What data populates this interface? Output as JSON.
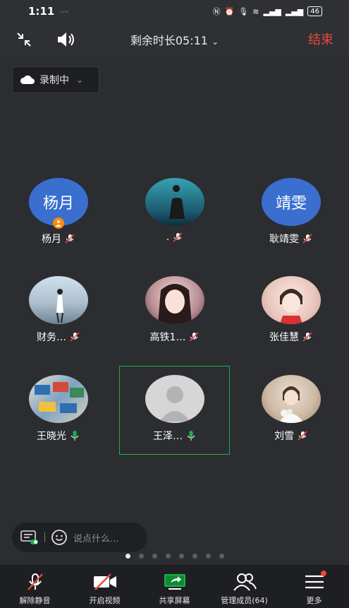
{
  "status_bar": {
    "time": "1:11",
    "battery": "46"
  },
  "top_bar": {
    "remaining": "剩余时长05:11",
    "end_label": "结束"
  },
  "record": {
    "label": "录制中"
  },
  "members": [
    {
      "name": "杨月",
      "avatar_text": "杨月",
      "host": true,
      "muted": true,
      "avatar_color": "#3a6fd0"
    },
    {
      "name": ".",
      "avatar_text": "",
      "host": false,
      "muted": true,
      "avatar_color": "#4aa3b8"
    },
    {
      "name": "耿靖雯",
      "avatar_text": "靖雯",
      "host": false,
      "muted": true,
      "avatar_color": "#3a6fd0"
    },
    {
      "name": "财务…",
      "avatar_text": "",
      "host": false,
      "muted": true,
      "avatar_color": "#9fb0c0"
    },
    {
      "name": "高铁1…",
      "avatar_text": "",
      "host": false,
      "muted": true,
      "avatar_color": "#d9b0b5"
    },
    {
      "name": "张佳慧",
      "avatar_text": "",
      "host": false,
      "muted": true,
      "avatar_color": "#e6c8c0"
    },
    {
      "name": "王晓光",
      "avatar_text": "",
      "host": false,
      "muted": false,
      "avatar_color": "#7c97b8"
    },
    {
      "name": "王泽…",
      "avatar_text": "",
      "host": false,
      "muted": false,
      "avatar_color": "#d0d0d0"
    },
    {
      "name": "刘雪",
      "avatar_text": "",
      "host": false,
      "muted": true,
      "avatar_color": "#c7b39a"
    }
  ],
  "chat": {
    "placeholder": "说点什么..."
  },
  "page_dots": {
    "total": 8,
    "active": 0
  },
  "toolbar": {
    "unmute": "解除静音",
    "video": "开启视频",
    "share": "共享屏幕",
    "members": "管理成员(64)",
    "more": "更多"
  },
  "colors": {
    "accent_green": "#19b34a",
    "end_red": "#e8483d",
    "avatar_blue": "#3a6fd0"
  }
}
